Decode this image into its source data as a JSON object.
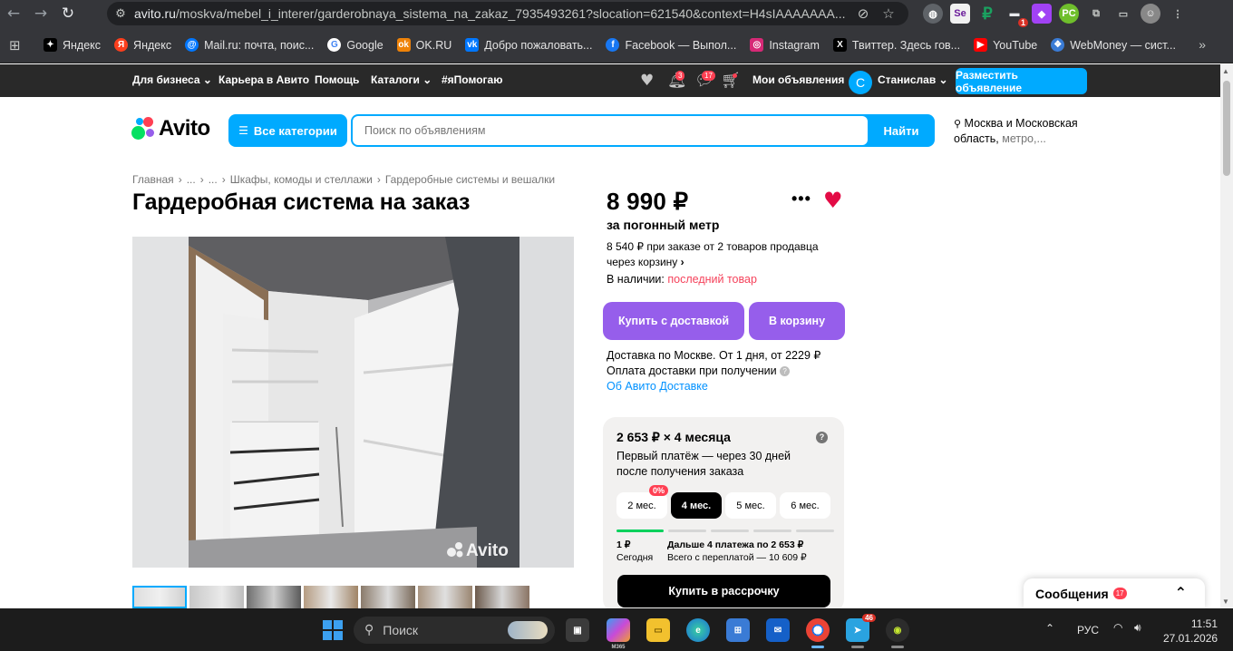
{
  "browser": {
    "url_host": "avito.ru",
    "url_rest": "/moskva/mebel_i_interer/garderobnaya_sistema_na_zakaz_7935493261?slocation=621540&context=H4sIAAAAAAA...",
    "bookmarks": [
      "Яндекс",
      "Яндекс",
      "Mail.ru: почта, поис...",
      "Google",
      "OK.RU",
      "Добро пожаловать...",
      "Facebook — Выпол...",
      "Instagram",
      "Твиттер. Здесь гов...",
      "YouTube",
      "WebMoney — сист..."
    ],
    "ext_badge": "1"
  },
  "avito_bar": {
    "links": [
      "Для бизнеса",
      "Карьера в Авито",
      "Помощь",
      "Каталоги",
      "#яПомогаю"
    ],
    "notif_badge": "3",
    "msg_badge": "17",
    "my_ads": "Мои объявления",
    "avatar_letter": "С",
    "user_name": "Станислав",
    "post_button": "Разместить объявление"
  },
  "search": {
    "logo": "Avito",
    "all_categories": "Все категории",
    "placeholder": "Поиск по объявлениям",
    "button": "Найти",
    "location_line1": "Москва и Московская",
    "location_line2": "область,",
    "location_metro": "метро,..."
  },
  "breadcrumbs": [
    "Главная",
    "›",
    "...",
    "›",
    "...",
    "›",
    "Шкафы, комоды и стеллажи",
    "›",
    "Гардеробные системы и вешалки"
  ],
  "listing": {
    "title": "Гардеробная система на заказ",
    "watermark": "Avito",
    "price": "8 990 ₽",
    "price_unit": "за погонный метр",
    "price_note_1": "8 540 ₽ при заказе от 2 товаров продавца",
    "price_note_2": "через корзину",
    "stock_label": "В наличии:",
    "stock_value": "последний товар",
    "buy_delivery": "Купить с доставкой",
    "to_cart": "В корзину",
    "delivery_line": "Доставка по Москве. От 1 дня, от 2229 ₽",
    "payment_line": "Оплата доставки при получении",
    "about_delivery": "Об Авито Доставке"
  },
  "installment": {
    "title": "2 653 ₽ × 4 месяца",
    "subtitle_1": "Первый платёж — через 30 дней",
    "subtitle_2": "после получения заказа",
    "tabs": [
      "2 мес.",
      "4 мес.",
      "5 мес.",
      "6 мес."
    ],
    "zero_badge": "0%",
    "first_amount": "1 ₽",
    "first_label": "Сегодня",
    "rest_amount": "Дальше 4 платежа по 2 653 ₽",
    "rest_label": "Всего с переплатой — 10 609 ₽",
    "buy_button": "Купить в рассрочку"
  },
  "messages": {
    "label": "Сообщения",
    "count": "17"
  },
  "taskbar": {
    "search_label": "Поиск",
    "m365_label": "M365",
    "telegram_badge": "46",
    "lang": "РУС",
    "time": "11:51",
    "date": "27.01.2026"
  },
  "colors": {
    "accent_blue": "#00aaff",
    "purple": "#965eeb",
    "favorite_red": "#e30b45",
    "warning": "#f5425b"
  }
}
